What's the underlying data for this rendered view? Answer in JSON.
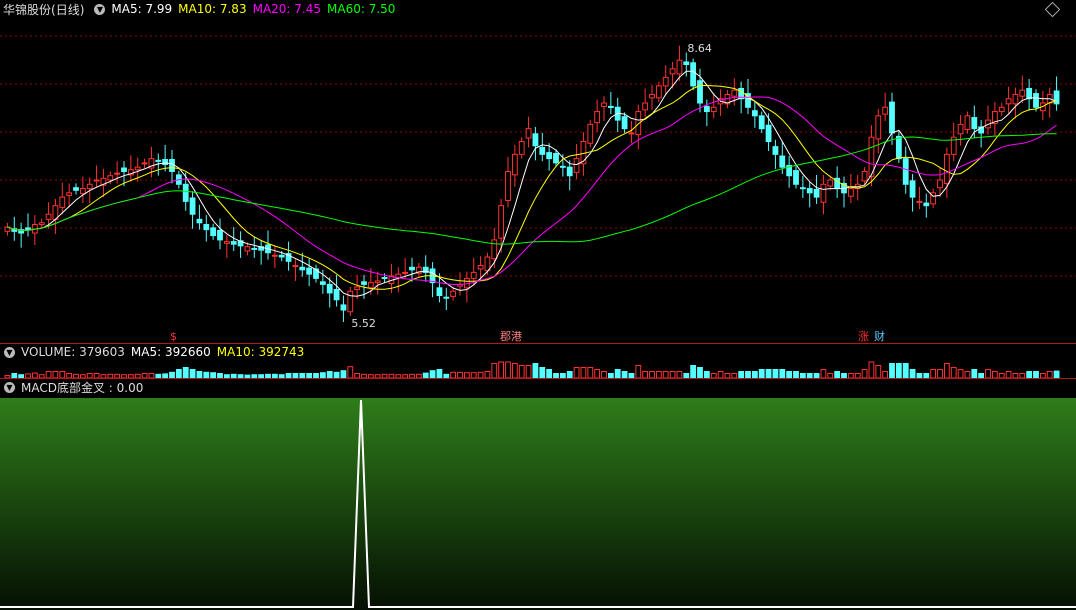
{
  "header": {
    "stock_name": "华锦股份",
    "period": "(日线)",
    "ma5_label": "MA5: 7.99",
    "ma10_label": "MA10: 7.83",
    "ma20_label": "MA20: 7.45",
    "ma60_label": "MA60: 7.50"
  },
  "annotations": {
    "high": "8.64",
    "low": "5.52",
    "marker_s": "$",
    "marker_a": "郡港",
    "marker_b": "涨",
    "marker_c": "财"
  },
  "volume_panel": {
    "title": "VOLUME: 379603",
    "ma5": "MA5: 392660",
    "ma10": "MA10: 392743"
  },
  "macd_panel": {
    "title": "MACD底部金叉 : 0.00"
  },
  "colors": {
    "up": "#ff3232",
    "down": "#54ffff",
    "ma5": "#ffffff",
    "ma10": "#ffff00",
    "ma20": "#ff00ff",
    "ma60": "#00ff00",
    "grid": "#8b0000"
  },
  "chart_data": [
    {
      "type": "candlestick",
      "title": "华锦股份 (日线)",
      "y_range": [
        5.3,
        8.9
      ],
      "ma": {
        "MA5": 7.99,
        "MA10": 7.83,
        "MA20": 7.45,
        "MA60": 7.5
      },
      "high_annotation": 8.64,
      "low_annotation": 5.52,
      "close": [
        6.55,
        6.5,
        6.48,
        6.52,
        6.58,
        6.6,
        6.7,
        6.8,
        6.9,
        6.95,
        6.98,
        7.0,
        7.05,
        7.1,
        7.12,
        7.15,
        7.18,
        7.2,
        7.22,
        7.25,
        7.3,
        7.35,
        7.32,
        7.28,
        7.2,
        7.05,
        6.85,
        6.7,
        6.6,
        6.52,
        6.45,
        6.4,
        6.38,
        6.35,
        6.33,
        6.32,
        6.3,
        6.28,
        6.25,
        6.22,
        6.2,
        6.15,
        6.1,
        6.05,
        6.0,
        5.95,
        5.88,
        5.78,
        5.7,
        5.58,
        5.8,
        5.85,
        5.88,
        5.9,
        5.92,
        5.95,
        5.98,
        6.0,
        6.02,
        6.05,
        6.08,
        6.02,
        5.9,
        5.75,
        5.72,
        5.8,
        5.88,
        5.95,
        6.02,
        6.1,
        6.2,
        6.4,
        6.8,
        7.2,
        7.4,
        7.55,
        7.7,
        7.5,
        7.4,
        7.35,
        7.3,
        7.25,
        7.15,
        7.35,
        7.55,
        7.75,
        7.9,
        8.0,
        7.95,
        7.8,
        7.7,
        7.65,
        7.9,
        8.0,
        8.1,
        8.2,
        8.3,
        8.4,
        8.5,
        8.45,
        8.2,
        8.0,
        7.9,
        7.95,
        8.05,
        8.1,
        8.15,
        8.05,
        7.95,
        7.85,
        7.7,
        7.55,
        7.4,
        7.25,
        7.15,
        7.05,
        7.0,
        6.95,
        6.9,
        7.05,
        7.1,
        7.0,
        6.95,
        7.0,
        7.05,
        7.2,
        7.6,
        7.85,
        7.95,
        7.65,
        7.35,
        7.05,
        6.9,
        6.85,
        6.8,
        6.95,
        7.1,
        7.4,
        7.6,
        7.75,
        7.85,
        7.7,
        7.65,
        7.8,
        7.9,
        7.95,
        8.05,
        8.1,
        8.15,
        8.05,
        7.95,
        8.0,
        8.1,
        7.99
      ]
    },
    {
      "type": "bar",
      "title": "VOLUME",
      "latest": 379603,
      "ma5": 392660,
      "ma10": 392743
    },
    {
      "type": "line",
      "title": "MACD底部金叉",
      "latest": 0.0,
      "signal_index": 59,
      "count": 160
    }
  ]
}
